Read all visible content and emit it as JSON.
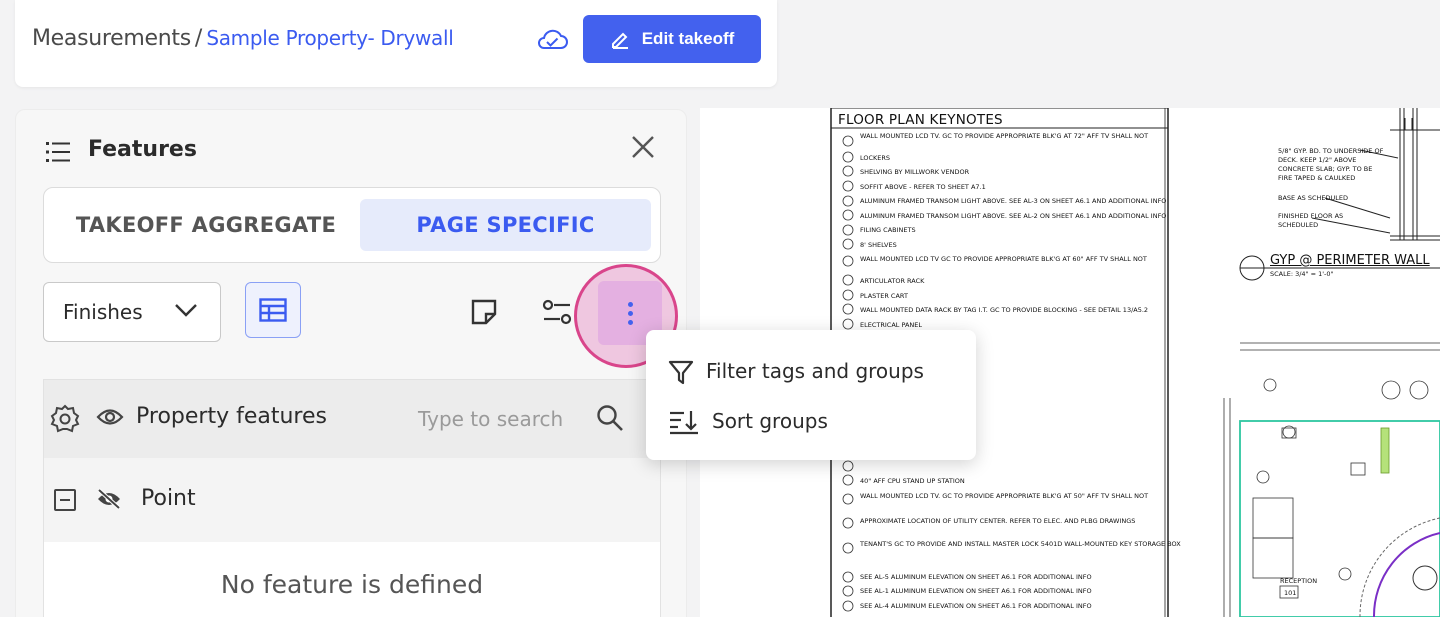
{
  "header": {
    "breadcrumb_root": "Measurements",
    "breadcrumb_sep": "/",
    "breadcrumb_current": "Sample Property- Drywall",
    "edit_label": "Edit takeoff"
  },
  "panel": {
    "title": "Features",
    "tabs": [
      {
        "label": "TAKEOFF AGGREGATE",
        "active": false
      },
      {
        "label": "PAGE SPECIFIC",
        "active": true
      }
    ],
    "dropdown_value": "Finishes",
    "group_label": "Property features",
    "search_placeholder": "Type to search",
    "subgroup_label": "Point",
    "empty_message": "No feature is defined"
  },
  "menu": {
    "items": [
      {
        "label": "Filter tags and groups",
        "icon": "filter-icon"
      },
      {
        "label": "Sort groups",
        "icon": "sort-icon"
      }
    ]
  },
  "drawing": {
    "keynotes_title": "FLOOR PLAN KEYNOTES",
    "keynotes": [
      "WALL MOUNTED LCD TV. GC TO PROVIDE APPROPRIATE BLK'G AT 72\" AFF TV SHALL NOT",
      "LOCKERS",
      "SHELVING BY MILLWORK VENDOR",
      "SOFFIT ABOVE - REFER TO SHEET A7.1",
      "ALUMINUM FRAMED TRANSOM LIGHT ABOVE. SEE AL-3 ON SHEET A6.1 AND ADDITIONAL INFO",
      "ALUMINUM FRAMED TRANSOM LIGHT ABOVE. SEE AL-2 ON SHEET A6.1 AND ADDITIONAL INFO",
      "FILING CABINETS",
      "8' SHELVES",
      "WALL MOUNTED LCD TV GC TO PROVIDE APPROPRIATE BLK'G AT 60\" AFF TV SHALL NOT",
      "ARTICULATOR RACK",
      "PLASTER CART",
      "WALL MOUNTED DATA RACK BY TAG I.T. GC TO PROVIDE BLOCKING - SEE DETAIL 13/A5.2",
      "ELECTRICAL PANEL",
      "40\" AFF CPU STAND UP STATION",
      "WALL MOUNTED LCD TV. GC TO PROVIDE APPROPRIATE BLK'G AT 50\" AFF TV SHALL NOT",
      "APPROXIMATE LOCATION OF UTILITY CENTER. REFER TO ELEC. AND PLBG DRAWINGS",
      "TENANT'S GC TO PROVIDE AND INSTALL MASTER LOCK 5401D WALL-MOUNTED KEY STORAGE BOX",
      "SEE AL-5 ALUMINUM ELEVATION ON SHEET A6.1 FOR ADDITIONAL INFO",
      "SEE AL-1 ALUMINUM ELEVATION ON SHEET A6.1 FOR ADDITIONAL INFO",
      "SEE AL-4 ALUMINUM ELEVATION ON SHEET A6.1 FOR ADDITIONAL INFO"
    ],
    "detail_title": "GYP @ PERIMETER WALL",
    "detail_notes": [
      "5/8\" GYP. BD. TO UNDERSIDE OF",
      "DECK. KEEP 1/2\" ABOVE",
      "CONCRETE SLAB; GYP. TO BE",
      "FIRE TAPED & CAULKED",
      "BASE AS SCHEDULED",
      "FINISHED FLOOR AS",
      "SCHEDULED"
    ],
    "scale_text": "SCALE:   3/4\" = 1'-0\"",
    "room_label": "RECEPTION",
    "room_number": "101"
  }
}
